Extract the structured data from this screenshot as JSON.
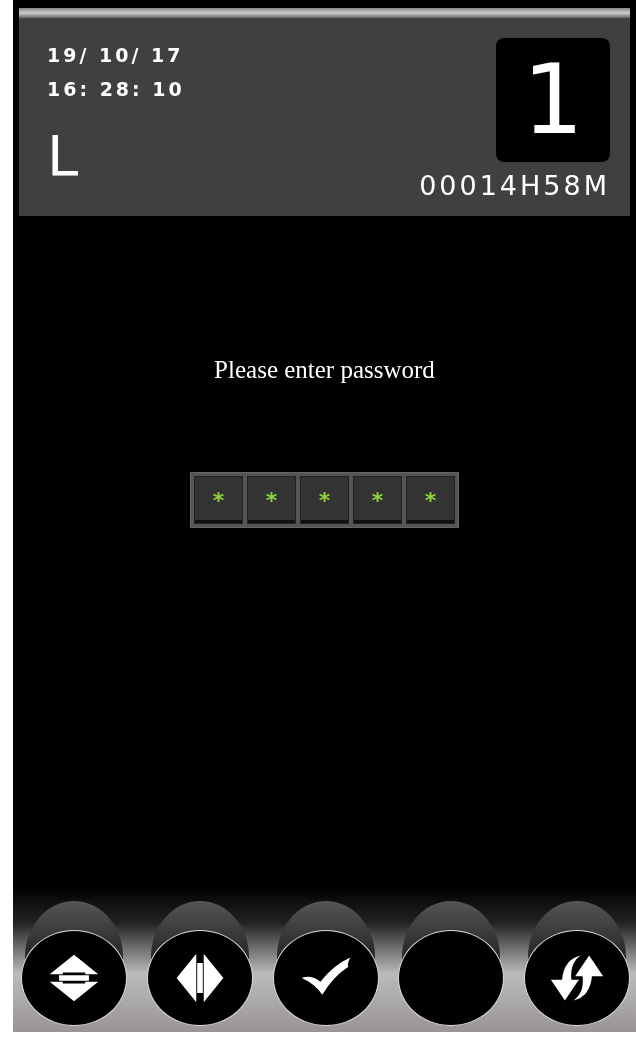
{
  "status_panel": {
    "date": "19/ 10/ 17",
    "time": "16: 28: 10",
    "mode": "L",
    "number": "1",
    "run_time": "00014H58M"
  },
  "prompt": "Please enter password",
  "password_digits": [
    "*",
    "*",
    "*",
    "*",
    "*"
  ],
  "buttons": [
    {
      "kind": "vertical"
    },
    {
      "kind": "horizontal"
    },
    {
      "kind": "confirm"
    },
    {
      "kind": "blank"
    },
    {
      "kind": "swap"
    }
  ]
}
